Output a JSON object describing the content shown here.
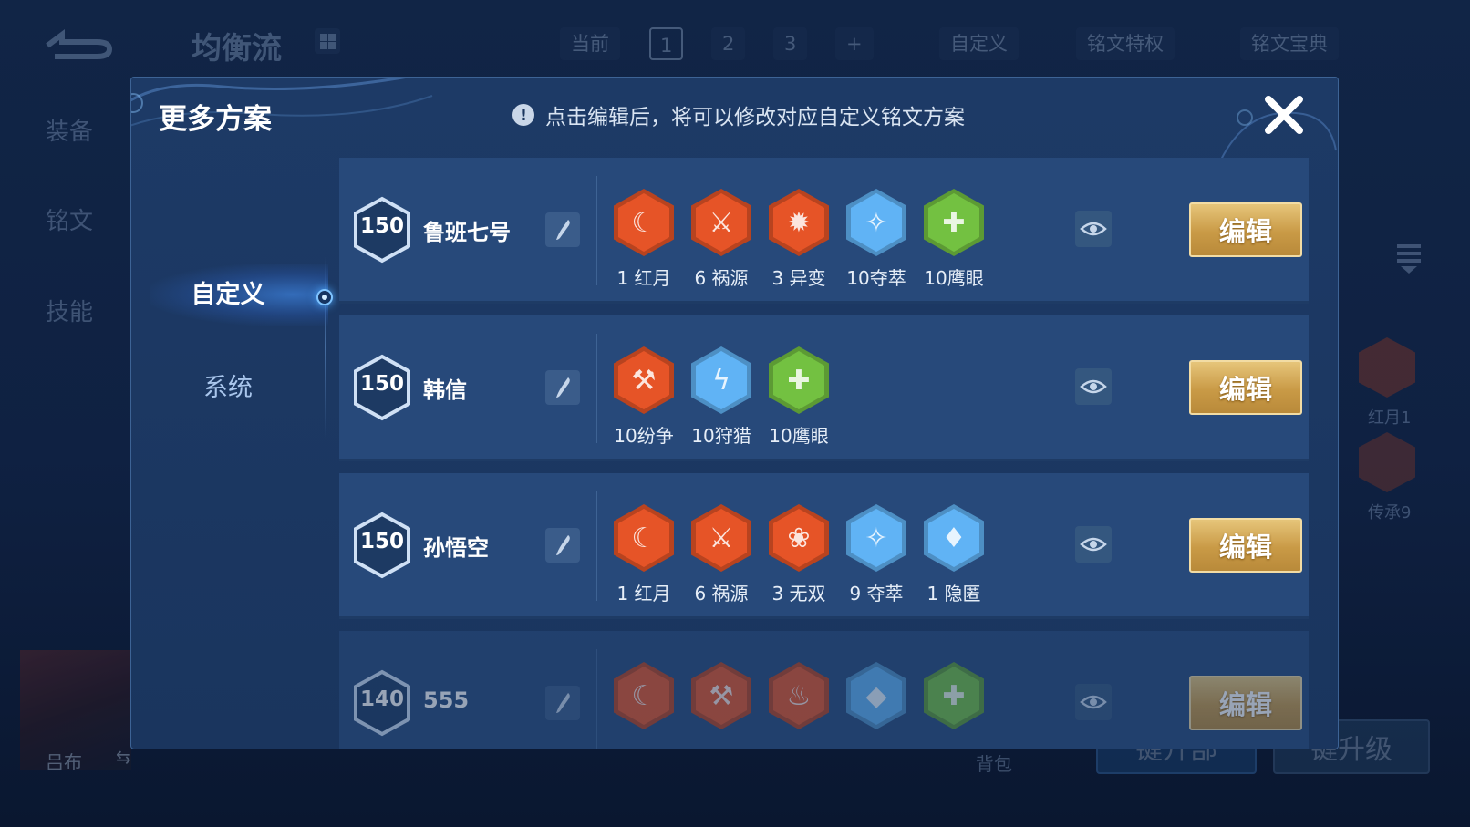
{
  "background": {
    "title": "均衡流",
    "page_tabs": [
      "当前",
      "1",
      "2",
      "3",
      "+"
    ],
    "custom_label": "自定义",
    "rune_privilege": "铭文特权",
    "rune_codex": "铭文宝典",
    "side_nav": [
      "装备",
      "铭文",
      "技能"
    ],
    "hero_name": "吕布",
    "bag_label": "背包",
    "one_click_setup": "键升部",
    "one_click_upgrade": "键升级",
    "side_runes": [
      "红月1",
      "传承9"
    ]
  },
  "modal": {
    "title": "更多方案",
    "notice": "点击编辑后，将可以修改对应自定义铭文方案",
    "tabs": [
      {
        "label": "自定义",
        "active": true
      },
      {
        "label": "系统",
        "active": false
      }
    ],
    "edit_label": "编辑",
    "presets": [
      {
        "level": "150",
        "name": "鲁班七号",
        "runes": [
          {
            "label": "1 红月",
            "color": "red",
            "icon": "crescent-moon-icon"
          },
          {
            "label": "6 祸源",
            "color": "red",
            "icon": "fan-blades-icon"
          },
          {
            "label": "3 异变",
            "color": "red",
            "icon": "mutation-icon"
          },
          {
            "label": "10夺萃",
            "color": "blue",
            "icon": "triquetra-icon"
          },
          {
            "label": "10鹰眼",
            "color": "green",
            "icon": "eagle-eye-icon"
          }
        ]
      },
      {
        "level": "150",
        "name": "韩信",
        "runes": [
          {
            "label": "10纷争",
            "color": "red",
            "icon": "axe-icon"
          },
          {
            "label": "10狩猎",
            "color": "blue",
            "icon": "lightning-icon"
          },
          {
            "label": "10鹰眼",
            "color": "green",
            "icon": "eagle-eye-icon"
          }
        ]
      },
      {
        "level": "150",
        "name": "孙悟空",
        "runes": [
          {
            "label": "1 红月",
            "color": "red",
            "icon": "crescent-moon-icon"
          },
          {
            "label": "6 祸源",
            "color": "red",
            "icon": "fan-blades-icon"
          },
          {
            "label": "3 无双",
            "color": "red",
            "icon": "rose-icon"
          },
          {
            "label": "9 夺萃",
            "color": "blue",
            "icon": "triquetra-icon"
          },
          {
            "label": "1 隐匿",
            "color": "blue",
            "icon": "flame-drop-icon"
          }
        ]
      },
      {
        "level": "140",
        "name": "555",
        "runes": [
          {
            "label": "",
            "color": "red",
            "icon": "crescent-moon-icon"
          },
          {
            "label": "",
            "color": "red",
            "icon": "axe-icon"
          },
          {
            "label": "",
            "color": "red",
            "icon": "flame-icon"
          },
          {
            "label": "",
            "color": "blue",
            "icon": "crystal-icon"
          },
          {
            "label": "",
            "color": "green",
            "icon": "eagle-eye-icon"
          }
        ]
      }
    ]
  },
  "colors": {
    "red": "#b8431f",
    "blue": "#4d8fc4",
    "green": "#5c9a34",
    "gold": "#d1a554"
  }
}
